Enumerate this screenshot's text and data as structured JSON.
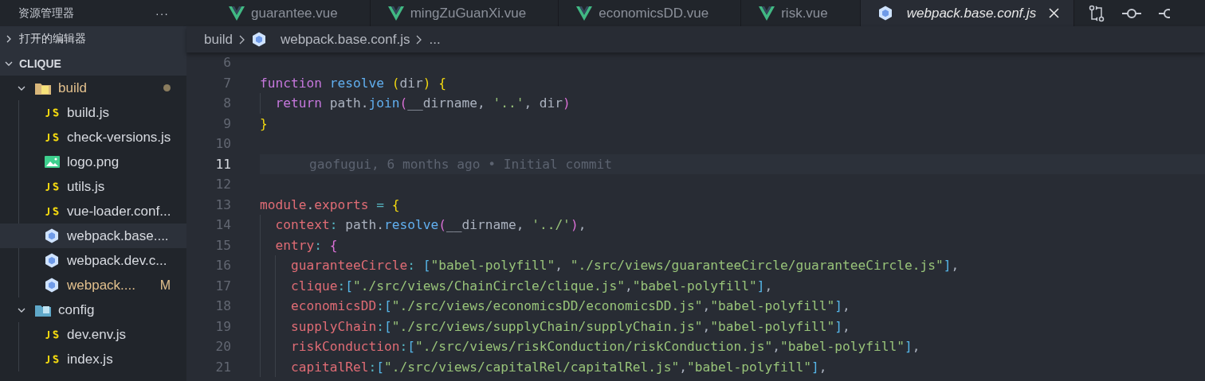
{
  "sidebar": {
    "title": "资源管理器",
    "more": "···",
    "sections": [
      {
        "label": "打开的编辑器",
        "expanded": false
      },
      {
        "label": "CLIQUE",
        "expanded": true,
        "children": [
          {
            "name": "build",
            "kind": "build-folder",
            "expanded": true,
            "modified": true,
            "selected": false,
            "children": [
              {
                "name": "build.js",
                "kind": "js",
                "modified": false,
                "selected": false
              },
              {
                "name": "check-versions.js",
                "kind": "js",
                "modified": false,
                "selected": false
              },
              {
                "name": "logo.png",
                "kind": "image",
                "modified": false,
                "selected": false
              },
              {
                "name": "utils.js",
                "kind": "js",
                "modified": false,
                "selected": false
              },
              {
                "name": "vue-loader.conf...",
                "kind": "js",
                "modified": false,
                "selected": false
              },
              {
                "name": "webpack.base....",
                "kind": "webpack",
                "modified": false,
                "selected": true
              },
              {
                "name": "webpack.dev.c...",
                "kind": "webpack",
                "modified": false,
                "selected": false
              },
              {
                "name": "webpack....",
                "kind": "webpack",
                "modified": true,
                "badge": "M",
                "selected": false
              }
            ]
          },
          {
            "name": "config",
            "kind": "config-folder",
            "expanded": true,
            "modified": false,
            "selected": false,
            "children": [
              {
                "name": "dev.env.js",
                "kind": "js",
                "modified": false,
                "selected": false
              },
              {
                "name": "index.js",
                "kind": "js",
                "modified": false,
                "selected": false
              }
            ]
          }
        ]
      }
    ]
  },
  "tabs": [
    {
      "label": "guarantee.vue",
      "kind": "vue",
      "selected": false
    },
    {
      "label": "mingZuGuanXi.vue",
      "kind": "vue",
      "selected": false
    },
    {
      "label": "economicsDD.vue",
      "kind": "vue",
      "selected": false
    },
    {
      "label": "risk.vue",
      "kind": "vue",
      "selected": false
    },
    {
      "label": "webpack.base.conf.js",
      "kind": "webpack",
      "selected": true
    }
  ],
  "breadcrumb": [
    "build",
    "webpack.base.conf.js",
    "..."
  ],
  "editor": {
    "lines": [
      {
        "number": "6",
        "current": false
      },
      {
        "number": "7",
        "current": false,
        "tokens": [
          {
            "t": "function ",
            "kind": "keyword"
          },
          {
            "t": "resolve ",
            "kind": "func"
          },
          {
            "t": "(",
            "kind": "bracket1"
          },
          {
            "t": "dir",
            "kind": "plain"
          },
          {
            "t": ") ",
            "kind": "bracket1"
          },
          {
            "t": "{",
            "kind": "bracket1"
          }
        ]
      },
      {
        "number": "8",
        "current": false,
        "tokens": [
          {
            "t": "  return ",
            "kind": "keyword"
          },
          {
            "t": "path.",
            "kind": "plain"
          },
          {
            "t": "join",
            "kind": "func"
          },
          {
            "t": "(",
            "kind": "bracket2"
          },
          {
            "t": "__dirname, ",
            "kind": "plain"
          },
          {
            "t": "'..'",
            "kind": "string"
          },
          {
            "t": ", dir",
            "kind": "plain"
          },
          {
            "t": ")",
            "kind": "bracket2"
          }
        ]
      },
      {
        "number": "9",
        "current": false,
        "tokens": [
          {
            "t": "}",
            "kind": "bracket1"
          }
        ]
      },
      {
        "number": "10",
        "current": false
      },
      {
        "number": "11",
        "current": true,
        "blame": "gaofugui, 6 months ago • Initial commit"
      },
      {
        "number": "12",
        "current": false
      },
      {
        "number": "13",
        "current": false,
        "tokens": [
          {
            "t": "module",
            "kind": "prop"
          },
          {
            "t": ".",
            "kind": "plain"
          },
          {
            "t": "exports",
            "kind": "prop"
          },
          {
            "t": " = ",
            "kind": "op"
          },
          {
            "t": "{",
            "kind": "bracket1"
          }
        ]
      },
      {
        "number": "14",
        "current": false,
        "tokens": [
          {
            "t": "  context",
            "kind": "prop"
          },
          {
            "t": ": ",
            "kind": "op"
          },
          {
            "t": "path.",
            "kind": "plain"
          },
          {
            "t": "resolve",
            "kind": "func"
          },
          {
            "t": "(",
            "kind": "bracket2"
          },
          {
            "t": "__dirname, ",
            "kind": "plain"
          },
          {
            "t": "'../'",
            "kind": "string"
          },
          {
            "t": ")",
            "kind": "bracket2"
          },
          {
            "t": ",",
            "kind": "plain"
          }
        ]
      },
      {
        "number": "15",
        "current": false,
        "tokens": [
          {
            "t": "  entry",
            "kind": "prop"
          },
          {
            "t": ": ",
            "kind": "op"
          },
          {
            "t": "{",
            "kind": "bracket2"
          }
        ]
      },
      {
        "number": "16",
        "current": false,
        "tokens": [
          {
            "t": "    guaranteeCircle",
            "kind": "prop"
          },
          {
            "t": ": ",
            "kind": "op"
          },
          {
            "t": "[",
            "kind": "bracket3"
          },
          {
            "t": "\"babel-polyfill\"",
            "kind": "string"
          },
          {
            "t": ", ",
            "kind": "plain"
          },
          {
            "t": "\"./src/views/guaranteeCircle/guaranteeCircle.js\"",
            "kind": "string"
          },
          {
            "t": "]",
            "kind": "bracket3"
          },
          {
            "t": ",",
            "kind": "plain"
          }
        ]
      },
      {
        "number": "17",
        "current": false,
        "tokens": [
          {
            "t": "    clique",
            "kind": "prop"
          },
          {
            "t": ":",
            "kind": "op"
          },
          {
            "t": "[",
            "kind": "bracket3"
          },
          {
            "t": "\"./src/views/ChainCircle/clique.js\"",
            "kind": "string"
          },
          {
            "t": ",",
            "kind": "plain"
          },
          {
            "t": "\"babel-polyfill\"",
            "kind": "string"
          },
          {
            "t": "]",
            "kind": "bracket3"
          },
          {
            "t": ",",
            "kind": "plain"
          }
        ]
      },
      {
        "number": "18",
        "current": false,
        "tokens": [
          {
            "t": "    economicsDD",
            "kind": "prop"
          },
          {
            "t": ":",
            "kind": "op"
          },
          {
            "t": "[",
            "kind": "bracket3"
          },
          {
            "t": "\"./src/views/economicsDD/economicsDD.js\"",
            "kind": "string"
          },
          {
            "t": ",",
            "kind": "plain"
          },
          {
            "t": "\"babel-polyfill\"",
            "kind": "string"
          },
          {
            "t": "]",
            "kind": "bracket3"
          },
          {
            "t": ",",
            "kind": "plain"
          }
        ]
      },
      {
        "number": "19",
        "current": false,
        "tokens": [
          {
            "t": "    supplyChain",
            "kind": "prop"
          },
          {
            "t": ":",
            "kind": "op"
          },
          {
            "t": "[",
            "kind": "bracket3"
          },
          {
            "t": "\"./src/views/supplyChain/supplyChain.js\"",
            "kind": "string"
          },
          {
            "t": ",",
            "kind": "plain"
          },
          {
            "t": "\"babel-polyfill\"",
            "kind": "string"
          },
          {
            "t": "]",
            "kind": "bracket3"
          },
          {
            "t": ",",
            "kind": "plain"
          }
        ]
      },
      {
        "number": "20",
        "current": false,
        "tokens": [
          {
            "t": "    riskConduction",
            "kind": "prop"
          },
          {
            "t": ":",
            "kind": "op"
          },
          {
            "t": "[",
            "kind": "bracket3"
          },
          {
            "t": "\"./src/views/riskConduction/riskConduction.js\"",
            "kind": "string"
          },
          {
            "t": ",",
            "kind": "plain"
          },
          {
            "t": "\"babel-polyfill\"",
            "kind": "string"
          },
          {
            "t": "]",
            "kind": "bracket3"
          },
          {
            "t": ",",
            "kind": "plain"
          }
        ]
      },
      {
        "number": "21",
        "current": false,
        "tokens": [
          {
            "t": "    capitalRel",
            "kind": "prop"
          },
          {
            "t": ":",
            "kind": "op"
          },
          {
            "t": "[",
            "kind": "bracket3"
          },
          {
            "t": "\"./src/views/capitalRel/capitalRel.js\"",
            "kind": "string"
          },
          {
            "t": ",",
            "kind": "plain"
          },
          {
            "t": "\"babel-polyfill\"",
            "kind": "string"
          },
          {
            "t": "]",
            "kind": "bracket3"
          },
          {
            "t": ",",
            "kind": "plain"
          }
        ]
      }
    ]
  }
}
